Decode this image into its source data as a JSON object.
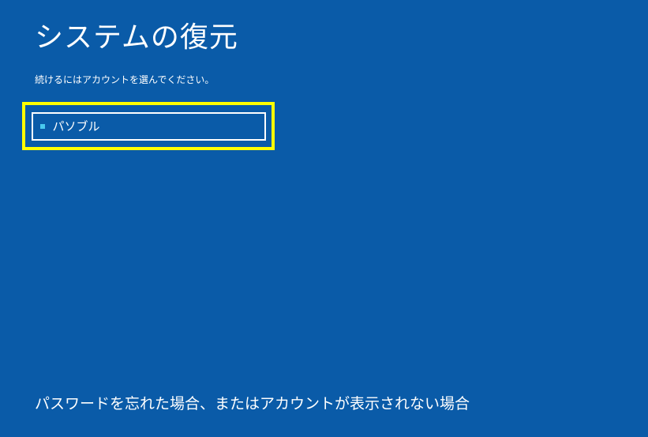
{
  "title": "システムの復元",
  "subtitle": "続けるにはアカウントを選んでください。",
  "account": {
    "label": "パソブル"
  },
  "footer": "パスワードを忘れた場合、またはアカウントが表示されない場合"
}
